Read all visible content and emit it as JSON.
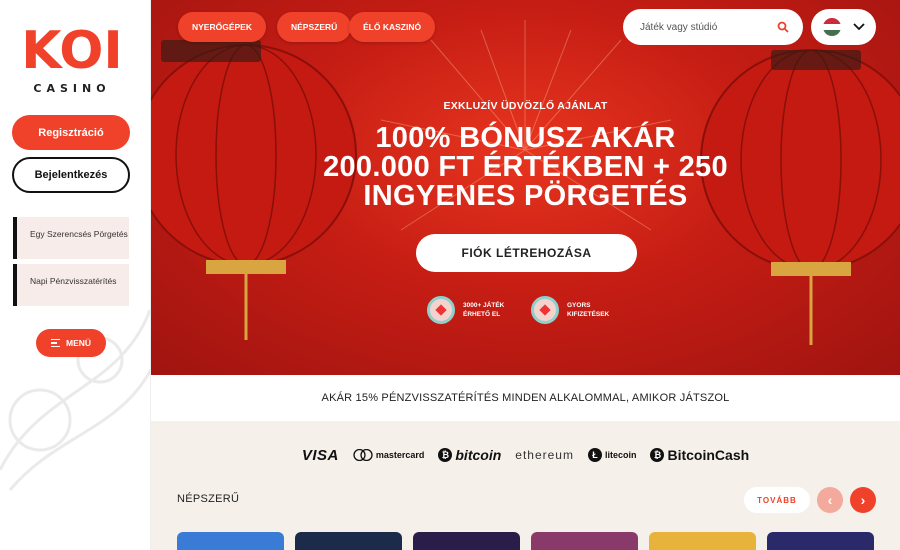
{
  "brand": {
    "logo_text": "KOI",
    "logo_sub": "CASINO",
    "accent": "#f0412a"
  },
  "sidebar": {
    "register_label": "Regisztráció",
    "login_label": "Bejelentkezés",
    "promos": [
      {
        "label": "Egy Szerencsés Pörgetés"
      },
      {
        "label": "Napi Pénzvisszatérítés"
      }
    ],
    "menu_label": "MENÜ"
  },
  "nav": {
    "tabs": [
      {
        "label": "NYERŐGÉPEK"
      },
      {
        "label": "NÉPSZERŰ"
      },
      {
        "label": "ÉLŐ KASZINÓ"
      }
    ],
    "search_placeholder": "Játék vagy stúdió",
    "language": "hungarian-flag"
  },
  "hero": {
    "subtitle": "EXKLUZÍV ÜDVÖZLŐ AJÁNLAT",
    "title_lines": [
      "100% BÓNUSZ AKÁR",
      "200.000 FT ÉRTÉKBEN + 250",
      "INGYENES PÖRGETÉS"
    ],
    "cta_label": "FIÓK LÉTREHOZÁSA",
    "features": [
      {
        "line1": "3000+ JÁTÉK",
        "line2": "ÉRHETŐ EL"
      },
      {
        "line1": "GYORS",
        "line2": "KIFIZETÉSEK"
      }
    ]
  },
  "cashback_strip": "AKÁR 15% PÉNZVISSZATÉRÍTÉS MINDEN ALKALOMMAL, AMIKOR JÁTSZOL",
  "payments": [
    "VISA",
    "mastercard",
    "bitcoin",
    "ethereum",
    "litecoin",
    "BitcoinCash"
  ],
  "popular": {
    "title": "NÉPSZERŰ",
    "more_label": "TOVÁBB",
    "thumb_colors": [
      "#3a7bd5",
      "#1d2b4a",
      "#2a1d4a",
      "#8a3a6a",
      "#e8b33a",
      "#2a2a6a"
    ]
  }
}
